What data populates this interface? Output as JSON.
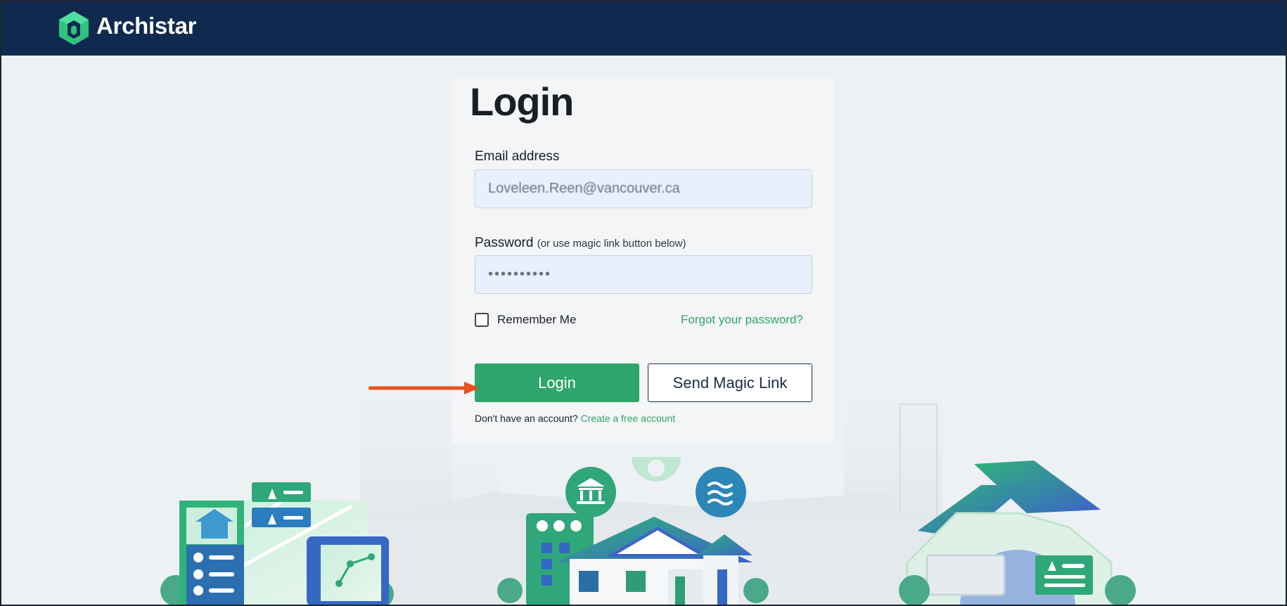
{
  "header": {
    "brand": "Archistar"
  },
  "login": {
    "title": "Login",
    "email_label": "Email address",
    "email_value": "Loveleen.Reen@vancouver.ca",
    "password_label": "Password",
    "password_hint": "(or use magic link button below)",
    "password_value": "••••••••••",
    "remember_label": "Remember Me",
    "forgot_link": "Forgot your password?",
    "login_button": "Login",
    "magic_button": "Send Magic Link",
    "signup_prompt": "Don't have an account?",
    "signup_link": "Create a free account"
  },
  "colors": {
    "header_bg": "#0f2a4e",
    "accent_green": "#2ea56b",
    "annotation_arrow": "#e8501e"
  }
}
